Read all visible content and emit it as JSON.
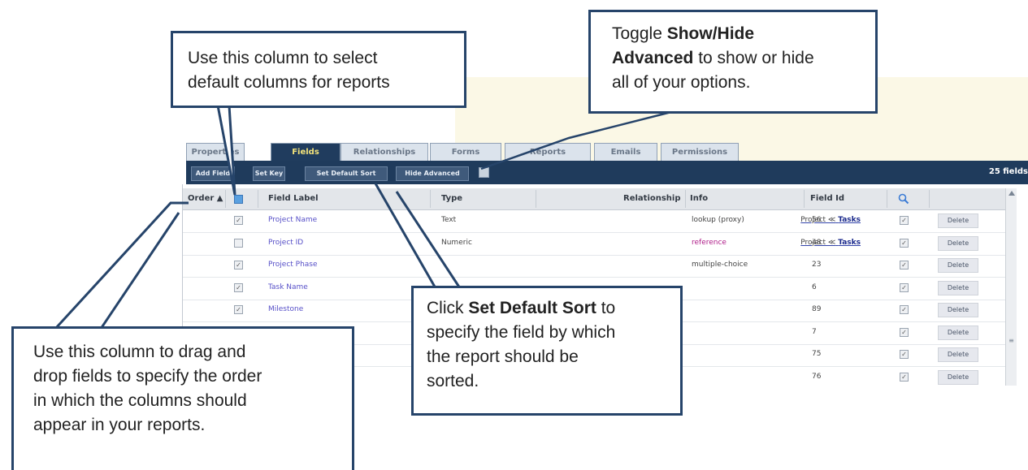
{
  "tabs": [
    "Properties",
    "Fields",
    "Relationships",
    "Forms",
    "Reports",
    "Emails",
    "Permissions"
  ],
  "toolbar": {
    "add_field": "Add Field",
    "set_key": "Set Key",
    "set_default_sort": "Set Default Sort",
    "hide_advanced": "Hide Advanced",
    "field_count": "25 fields"
  },
  "columns": {
    "order": "Order ▲",
    "field_label": "Field Label",
    "type": "Type",
    "relationship": "Relationship",
    "info": "Info",
    "field_id": "Field Id"
  },
  "rows": [
    {
      "checked": true,
      "label": "Project Name",
      "type": "Text",
      "rel_a": "Project ≪",
      "rel_b": "Tasks",
      "info": "lookup (proxy)",
      "field_id": "56",
      "search": true,
      "delete": "Delete"
    },
    {
      "checked": false,
      "label": "Project ID",
      "type": "Numeric",
      "rel_a": "Project ≪",
      "rel_b": "Tasks",
      "info": "reference",
      "field_id": "48",
      "search": true,
      "delete": "Delete"
    },
    {
      "checked": true,
      "label": "Project Phase",
      "type": "",
      "rel_a": "",
      "rel_b": "",
      "info": "multiple-choice",
      "field_id": "23",
      "search": true,
      "delete": "Delete"
    },
    {
      "checked": true,
      "label": "Task Name",
      "type": "",
      "rel_a": "",
      "rel_b": "",
      "info": "",
      "field_id": "6",
      "search": true,
      "delete": "Delete"
    },
    {
      "checked": true,
      "label": "Milestone",
      "type": "",
      "rel_a": "",
      "rel_b": "",
      "info": "",
      "field_id": "89",
      "search": true,
      "delete": "Delete"
    },
    {
      "checked": true,
      "label": "",
      "type": "",
      "rel_a": "",
      "rel_b": "",
      "info": "",
      "field_id": "7",
      "search": true,
      "delete": "Delete"
    },
    {
      "checked": true,
      "label": "",
      "type": "",
      "rel_a": "",
      "rel_b": "",
      "info": "",
      "field_id": "75",
      "search": true,
      "delete": "Delete"
    },
    {
      "checked": true,
      "label": "",
      "type": "",
      "rel_a": "",
      "rel_b": "",
      "info": "",
      "field_id": "76",
      "search": true,
      "delete": "Delete"
    }
  ],
  "callouts": {
    "select_columns": {
      "line1": "Use this column to select",
      "line2": "default columns for reports"
    },
    "toggle": {
      "pre": "Toggle ",
      "bold": "Show/Hide",
      "bold2": "Advanced",
      "post": " to show or hide",
      "line3": "all of your options."
    },
    "sort": {
      "pre": "Click ",
      "bold": "Set Default Sort",
      "post": " to",
      "line2": "specify the field by which",
      "line3": "the report should be",
      "line4": "sorted."
    },
    "order": {
      "line1": "Use this column to drag and",
      "line2": "drop fields to specify the order",
      "line3": "in which the columns should",
      "line4": "appear in your reports."
    }
  },
  "colors": {
    "toolbar": "#1f3b5c",
    "callout_border": "#26446a",
    "link": "#5750c8",
    "reference": "#b0208a"
  }
}
